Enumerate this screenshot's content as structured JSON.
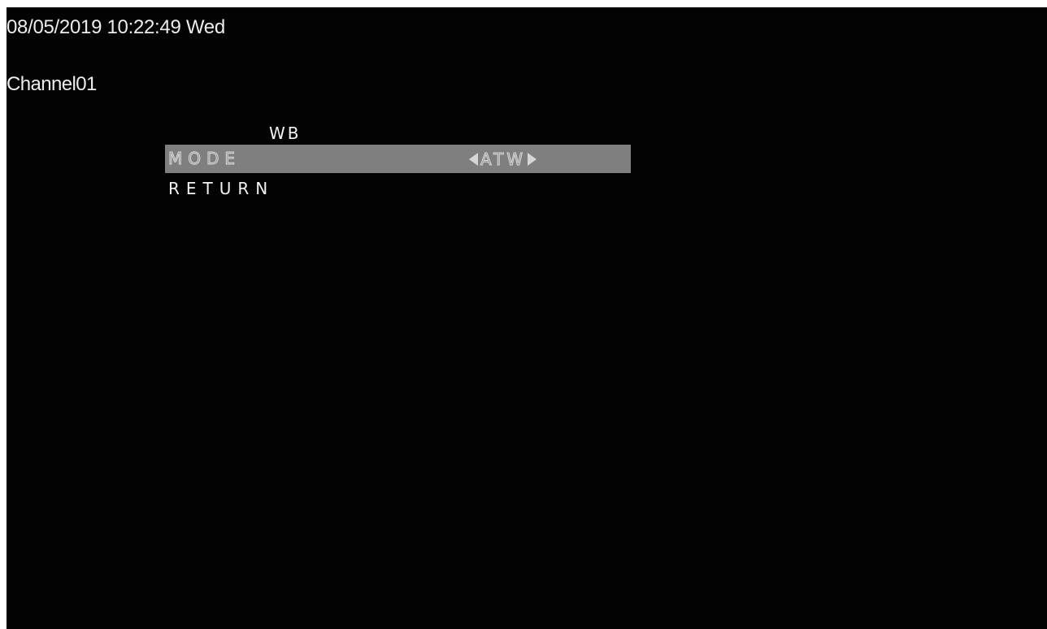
{
  "status": {
    "datetime": "08/05/2019 10:22:49 Wed",
    "channel": "Channel01"
  },
  "menu": {
    "title": "WB",
    "items": [
      {
        "label": "MODE",
        "value": "ATW",
        "selected": true,
        "left_arrow_icon": "triangle-left-icon",
        "right_arrow_icon": "triangle-right-icon"
      },
      {
        "label": "RETURN",
        "selected": false
      }
    ]
  },
  "colors": {
    "background": "#030303",
    "text": "#f2f2f2",
    "highlight": "#7f7f7f"
  }
}
